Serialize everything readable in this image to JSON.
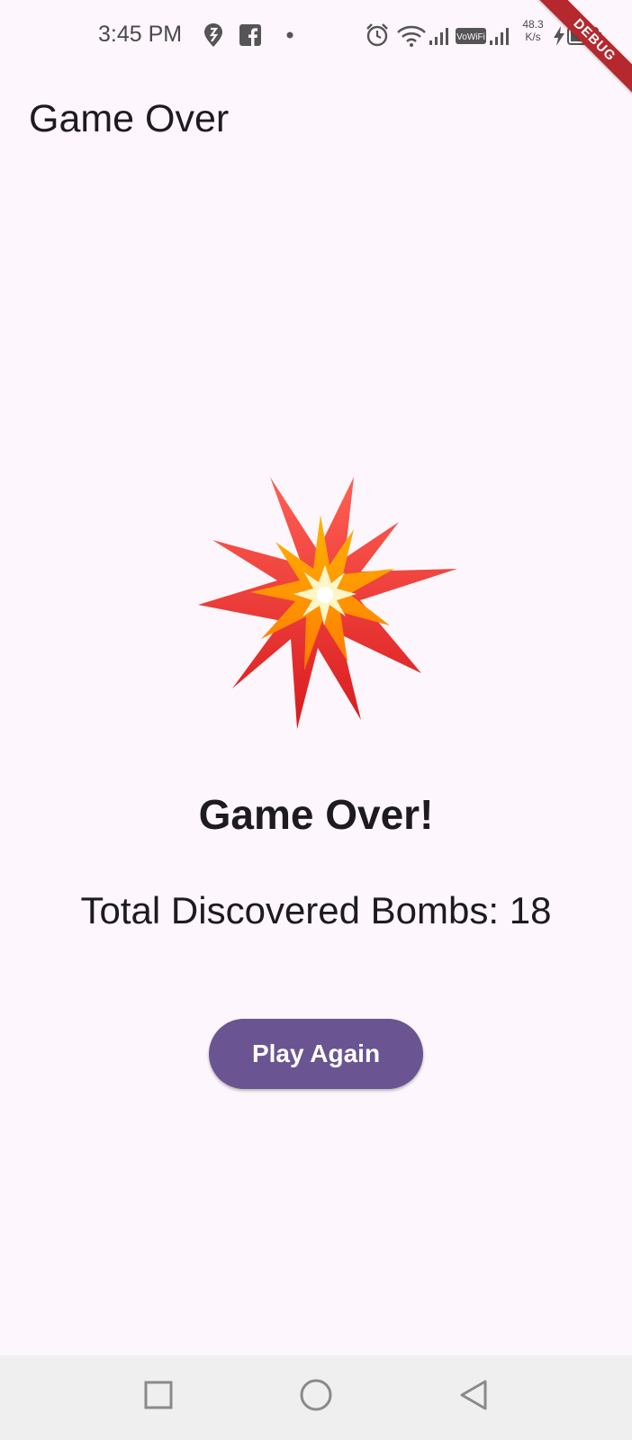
{
  "status_bar": {
    "time": "3:45 PM",
    "net_speed_value": "48.3",
    "net_speed_unit": "K/s",
    "vowifi_label": "VoWiFi",
    "icons": [
      "swiggy-icon",
      "facebook-icon",
      "notification-dot-icon",
      "alarm-icon",
      "wifi-icon",
      "cell-signal-icon",
      "vowifi-icon",
      "cell-signal-icon",
      "charging-icon",
      "battery-icon"
    ]
  },
  "debug_banner": "DEBUG",
  "app_bar": {
    "title": "Game Over"
  },
  "main": {
    "icon": "explosion-icon",
    "heading": "Game Over!",
    "bombs_label": "Total Discovered Bombs:",
    "bombs_count": "18",
    "play_again_label": "Play Again"
  },
  "nav_bar": {
    "buttons": [
      "recents-square-icon",
      "home-circle-icon",
      "back-triangle-icon"
    ]
  },
  "colors": {
    "background": "#fdf6fc",
    "button": "#6a5592",
    "button_text": "#ffffff",
    "text": "#1d1b20",
    "nav_bar": "#f0eff0",
    "debug_banner": "#b5282e"
  }
}
